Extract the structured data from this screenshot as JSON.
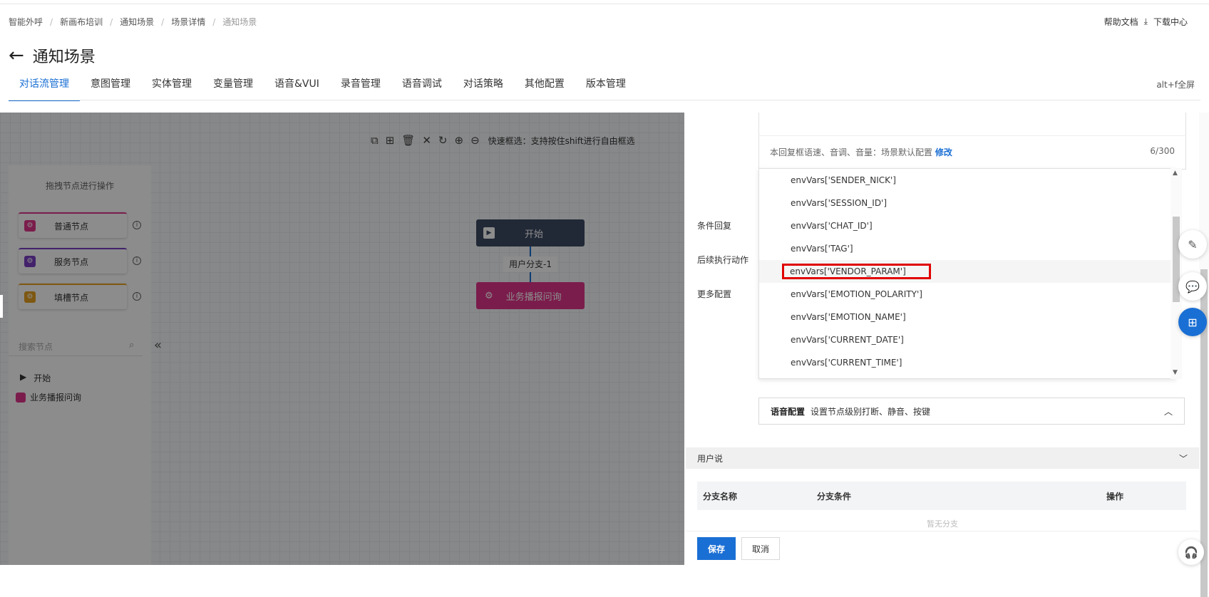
{
  "breadcrumb": [
    "智能外呼",
    "新画布培训",
    "通知场景",
    "场景详情",
    "通知场景"
  ],
  "header": {
    "help": "帮助文档",
    "download": "下载中心",
    "title": "通知场景",
    "fullscreen": "alt+f全屏"
  },
  "tabs": [
    "对话流管理",
    "意图管理",
    "实体管理",
    "变量管理",
    "语音&VUI",
    "录音管理",
    "语音调试",
    "对话策略",
    "其他配置",
    "版本管理"
  ],
  "toolbar": {
    "tip": "快速框选：支持按住shift进行自由框选"
  },
  "left_panel": {
    "title": "拖拽节点进行操作",
    "nodes": [
      "普通节点",
      "服务节点",
      "填槽节点"
    ],
    "search_placeholder": "搜索节点",
    "tree": [
      "开始",
      "业务播报问询"
    ]
  },
  "canvas": {
    "start_node": "开始",
    "branch_label": "用户分支-1",
    "business_node": "业务播报问询"
  },
  "side": {
    "labels": {
      "condition_reply": "条件回复",
      "followup": "后续执行动作",
      "more": "更多配置"
    },
    "reply_footer": {
      "text": "本回复框语速、音调、音量：场景默认配置",
      "link": "修改",
      "count": "6/300"
    },
    "dropdown_items": [
      "envVars['SENDER_NICK']",
      "envVars['SESSION_ID']",
      "envVars['CHAT_ID']",
      "envVars['TAG']",
      "envVars['VENDOR_PARAM']",
      "envVars['EMOTION_POLARITY']",
      "envVars['EMOTION_NAME']",
      "envVars['CURRENT_DATE']",
      "envVars['CURRENT_TIME']"
    ],
    "voice_config": {
      "title": "语音配置",
      "desc": "设置节点级别打断、静音、按键"
    },
    "user_says": "用户说",
    "branch_table": {
      "headers": [
        "分支名称",
        "分支条件",
        "操作"
      ],
      "empty": "暂无分支"
    },
    "buttons": {
      "save": "保存",
      "cancel": "取消"
    }
  },
  "colors": {
    "primary": "#1a6fd4",
    "normal_node": "#e0368a",
    "service_node": "#7b3fc4",
    "slot_node": "#e6a020",
    "highlight": "#e00000"
  }
}
